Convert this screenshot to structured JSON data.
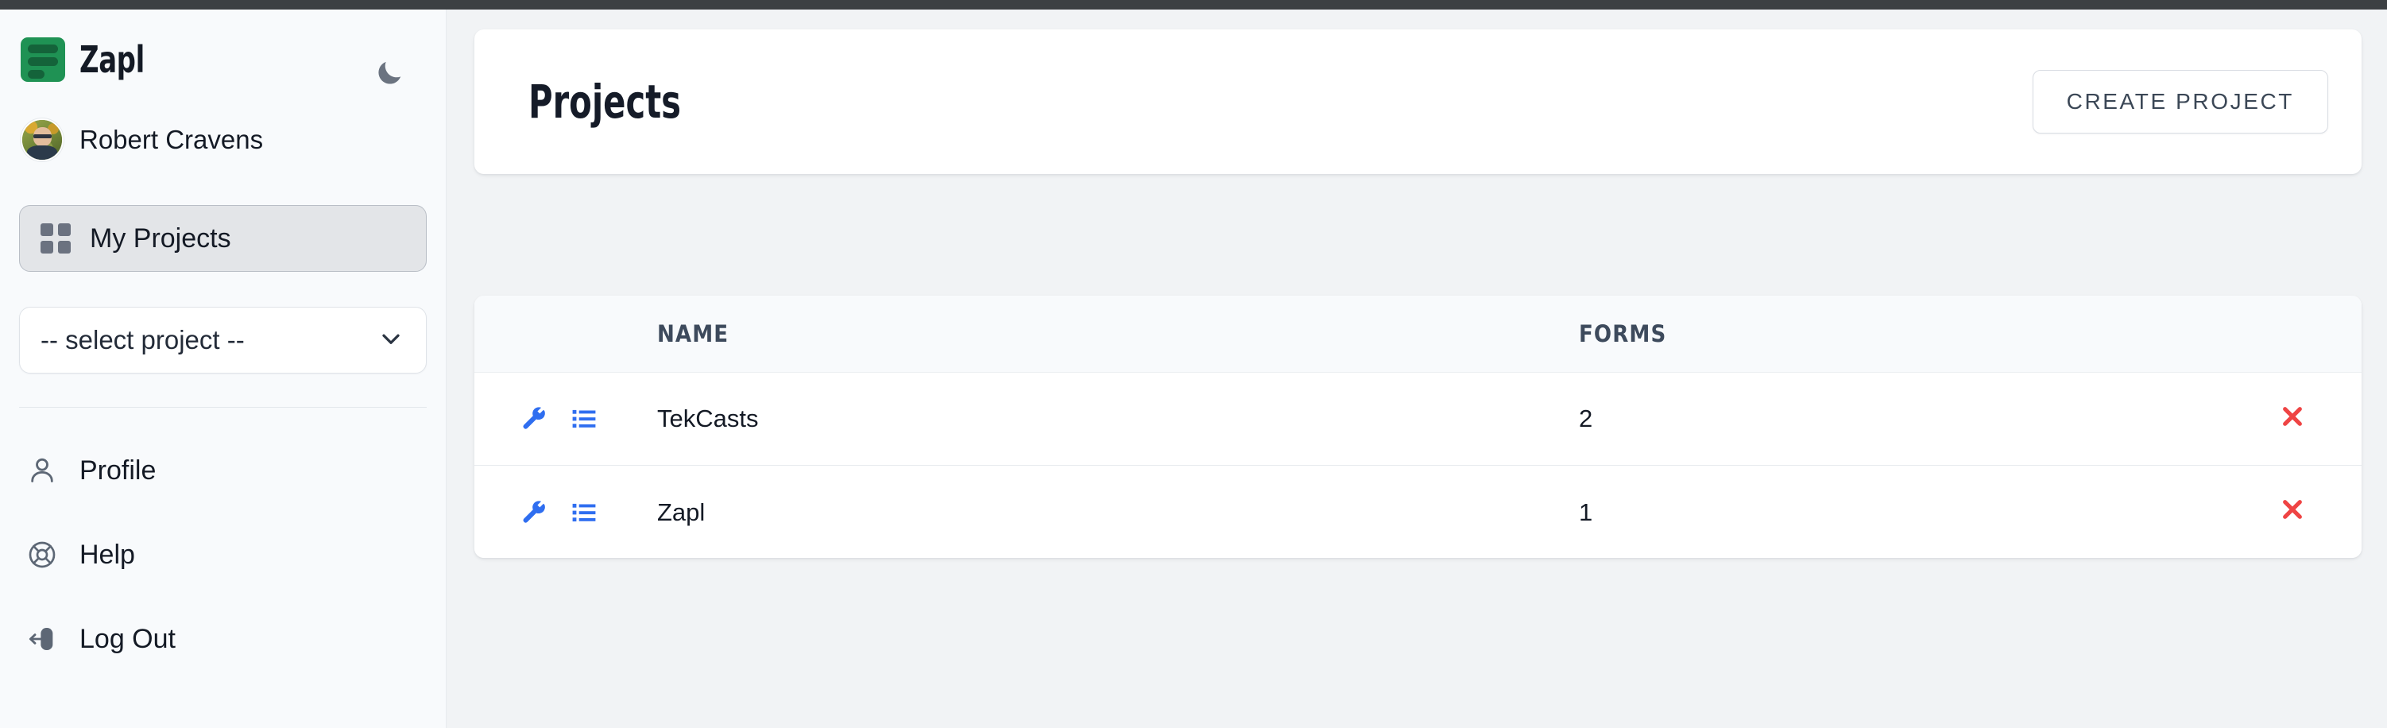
{
  "colors": {
    "brand_green": "#1f9254",
    "action_blue": "#2f6ef0",
    "delete_red": "#ef4444",
    "sidebar_bg": "#f8fafc",
    "main_bg": "#f1f3f5",
    "text_dark": "#141a25"
  },
  "sidebar": {
    "brand": {
      "name": "Zapl",
      "logo_icon": "zapl-form-logo-icon"
    },
    "theme_toggle": {
      "icon": "moon-icon"
    },
    "user": {
      "name": "Robert Cravens",
      "avatar": "user-avatar"
    },
    "active_nav": {
      "label": "My Projects",
      "icon": "grid-icon"
    },
    "project_select": {
      "value": "-- select project --",
      "chevron": "chevron-down-icon"
    },
    "items": [
      {
        "label": "Profile",
        "icon": "person-icon"
      },
      {
        "label": "Help",
        "icon": "life-ring-icon"
      },
      {
        "label": "Log Out",
        "icon": "logout-icon"
      }
    ]
  },
  "header": {
    "title": "Projects",
    "create_label": "CREATE PROJECT"
  },
  "table": {
    "columns": [
      "NAME",
      "FORMS"
    ],
    "rows": [
      {
        "name": "TekCasts",
        "forms": "2",
        "settings_icon": "wrench-icon",
        "forms_icon": "list-icon",
        "delete_icon": "close-x-icon"
      },
      {
        "name": "Zapl",
        "forms": "1",
        "settings_icon": "wrench-icon",
        "forms_icon": "list-icon",
        "delete_icon": "close-x-icon"
      }
    ]
  }
}
